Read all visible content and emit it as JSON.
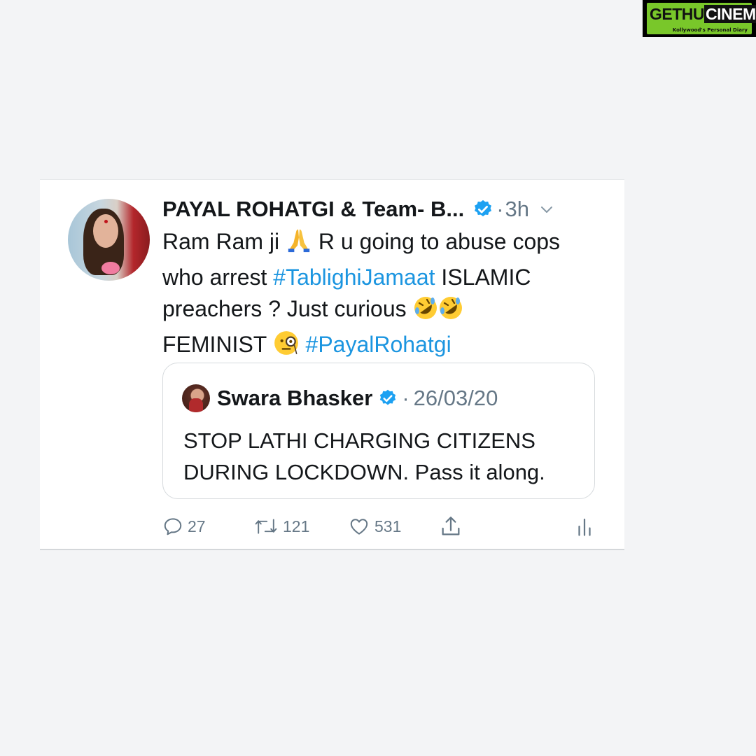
{
  "watermark": {
    "brand_part1": "GETHU",
    "brand_part2": "CINEMA",
    "tagline": "Kollywood's Personal Diary"
  },
  "tweet": {
    "author_name": "PAYAL ROHATGI & Team- B...",
    "time": "3h",
    "separator": "·",
    "text_part1": "Ram Ram ji ",
    "text_part2": " R u going to abuse cops who arrest ",
    "hashtag1": "#TablighiJamaat",
    "text_part3": " ISLAMIC preachers ? Just curious ",
    "text_part4": " FEMINIST ",
    "hashtag2": "#PayalRohatgi",
    "quoted": {
      "author_name": "Swara Bhasker",
      "separator": "·",
      "date": "26/03/20",
      "text": "STOP LATHI CHARGING CITIZENS DURING LOCKDOWN. Pass it along."
    },
    "actions": {
      "replies": "27",
      "retweets": "121",
      "likes": "531"
    }
  },
  "colors": {
    "background": "#f3f4f6",
    "link": "#1b95e0",
    "verified": "#1da1f2",
    "secondary_text": "#657786",
    "logo_green": "#79c72a"
  },
  "icons": [
    "verified-badge-icon",
    "chevron-down-icon",
    "folded-hands-emoji",
    "rofl-emoji",
    "monocle-face-emoji",
    "reply-icon",
    "retweet-icon",
    "like-icon",
    "share-icon",
    "analytics-icon"
  ]
}
